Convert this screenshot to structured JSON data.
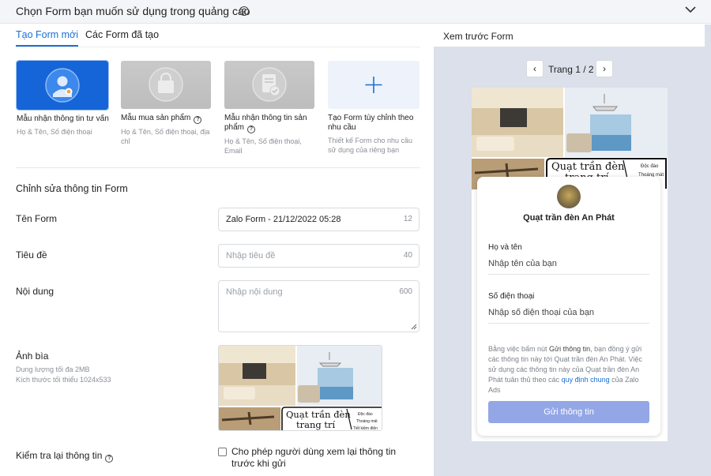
{
  "header": {
    "title": "Chọn Form bạn muốn sử dụng trong quảng cáo"
  },
  "tabs": [
    {
      "label": "Tạo Form mới",
      "active": true
    },
    {
      "label": "Các Form đã tạo",
      "active": false
    }
  ],
  "templates": [
    {
      "name": "Mẫu nhận thông tin tư vấn",
      "desc": "Họ & Tên, Số điện thoại",
      "selected": true
    },
    {
      "name": "Mẫu mua sản phẩm",
      "desc": "Họ & Tên, Số điện thoại, địa chỉ"
    },
    {
      "name": "Mẫu nhận thông tin sản phẩm",
      "desc": "Họ & Tên, Số điện thoại, Email"
    },
    {
      "name": "Tạo Form tùy chỉnh theo nhu cầu",
      "desc": "Thiết kế Form cho nhu cầu sử dụng của riêng bạn"
    }
  ],
  "edit": {
    "section_title": "Chỉnh sửa thông tin Form",
    "form_name": {
      "label": "Tên Form",
      "value": "Zalo Form - 21/12/2022 05:28",
      "count": "12"
    },
    "title": {
      "label": "Tiêu đề",
      "placeholder": "Nhập tiêu đề",
      "count": "40"
    },
    "content": {
      "label": "Nội dung",
      "placeholder": "Nhập nội dung",
      "count": "600"
    },
    "cover": {
      "label": "Ảnh bìa",
      "sub1": "Dung lượng tối đa 2MB",
      "sub2": "Kích thước tối thiểu 1024x533"
    },
    "review": {
      "label": "Kiểm tra lại thông tin",
      "checkbox_label": "Cho phép người dùng xem lại thông tin trước khi gửi"
    }
  },
  "cover_text": {
    "line1": "Quạt trần đèn",
    "line2": "trang trí",
    "small1": "Độc đáo",
    "small2": "Thoáng mát",
    "small3": "Tiết kiệm điện"
  },
  "preview": {
    "title": "Xem trước Form",
    "page": "Trang 1 / 2",
    "brand": "Quạt trần đèn An Phát",
    "field1_label": "Họ và tên",
    "field1_placeholder": "Nhập tên của bạn",
    "field2_label": "Số điện thoại",
    "field2_placeholder": "Nhập số điện thoại của bạn",
    "terms_pre": "Bằng việc bấm nút ",
    "terms_btn": "Gửi thông tin",
    "terms_mid": ", bạn đồng ý gửi các thông tin này tới Quạt trần đèn An Phát. Việc sử dụng các thông tin này của Quạt trần đèn An Phát tuân thủ theo các ",
    "terms_link": "quy định chung",
    "terms_post": " của Zalo Ads",
    "submit": "Gửi thông tin"
  },
  "colors": {
    "accent": "#1a6fd4",
    "selected_card": "#1565d8",
    "submit_button": "#93a7e6",
    "preview_bg": "#dbe0ea"
  }
}
